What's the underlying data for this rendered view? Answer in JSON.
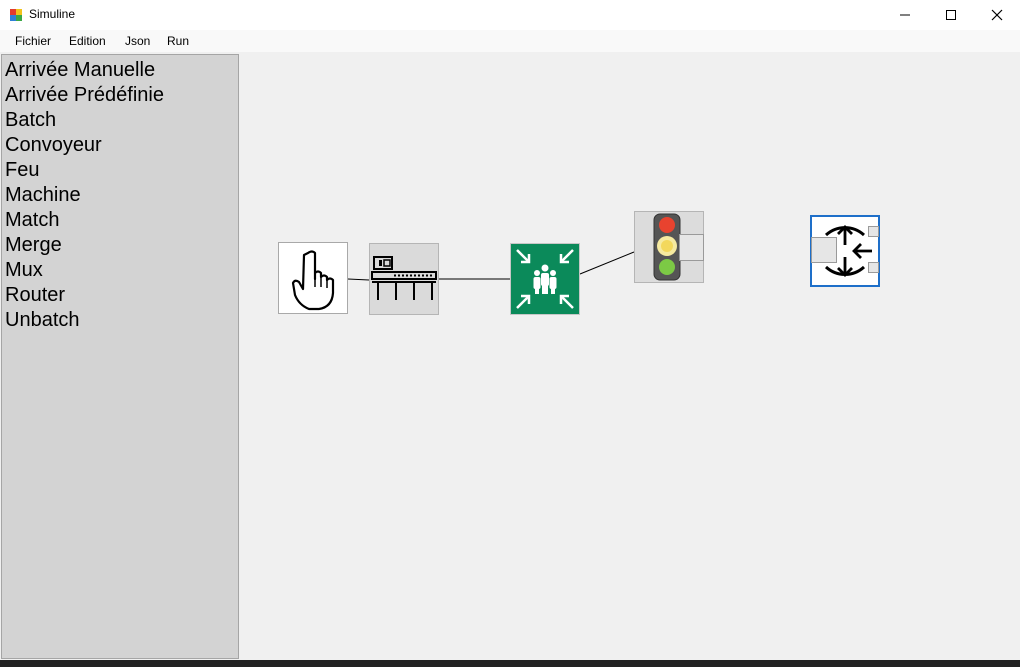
{
  "window": {
    "title": "Simuline",
    "icon": "simuline-app-icon",
    "controls": [
      "minimize-icon",
      "maximize-icon",
      "close-icon"
    ]
  },
  "menu": [
    {
      "label": "Fichier"
    },
    {
      "label": "Edition"
    },
    {
      "label": "Json"
    },
    {
      "label": "Run"
    }
  ],
  "palette": {
    "items": [
      {
        "label": "Arrivée Manuelle"
      },
      {
        "label": "Arrivée Prédéfinie"
      },
      {
        "label": "Batch"
      },
      {
        "label": "Convoyeur"
      },
      {
        "label": "Feu"
      },
      {
        "label": "Machine"
      },
      {
        "label": "Match"
      },
      {
        "label": "Merge"
      },
      {
        "label": "Mux"
      },
      {
        "label": "Router"
      },
      {
        "label": "Unbatch"
      }
    ]
  },
  "canvas": {
    "nodes": [
      {
        "kind": "arrivee-manuelle",
        "icon": "pointing-hand-icon",
        "selected": false
      },
      {
        "kind": "convoyeur",
        "icon": "conveyor-icon",
        "selected": false
      },
      {
        "kind": "merge",
        "icon": "assembly-point-icon",
        "selected": false
      },
      {
        "kind": "feu",
        "icon": "traffic-light-icon",
        "selected": false
      },
      {
        "kind": "router",
        "icon": "router-arrows-icon",
        "selected": true
      }
    ],
    "colors": {
      "assembly_green": "#0b8a5a",
      "selection_blue": "#1e6fc9",
      "palette_bg": "#d3d3d3",
      "canvas_bg": "#f0f0f0"
    }
  }
}
